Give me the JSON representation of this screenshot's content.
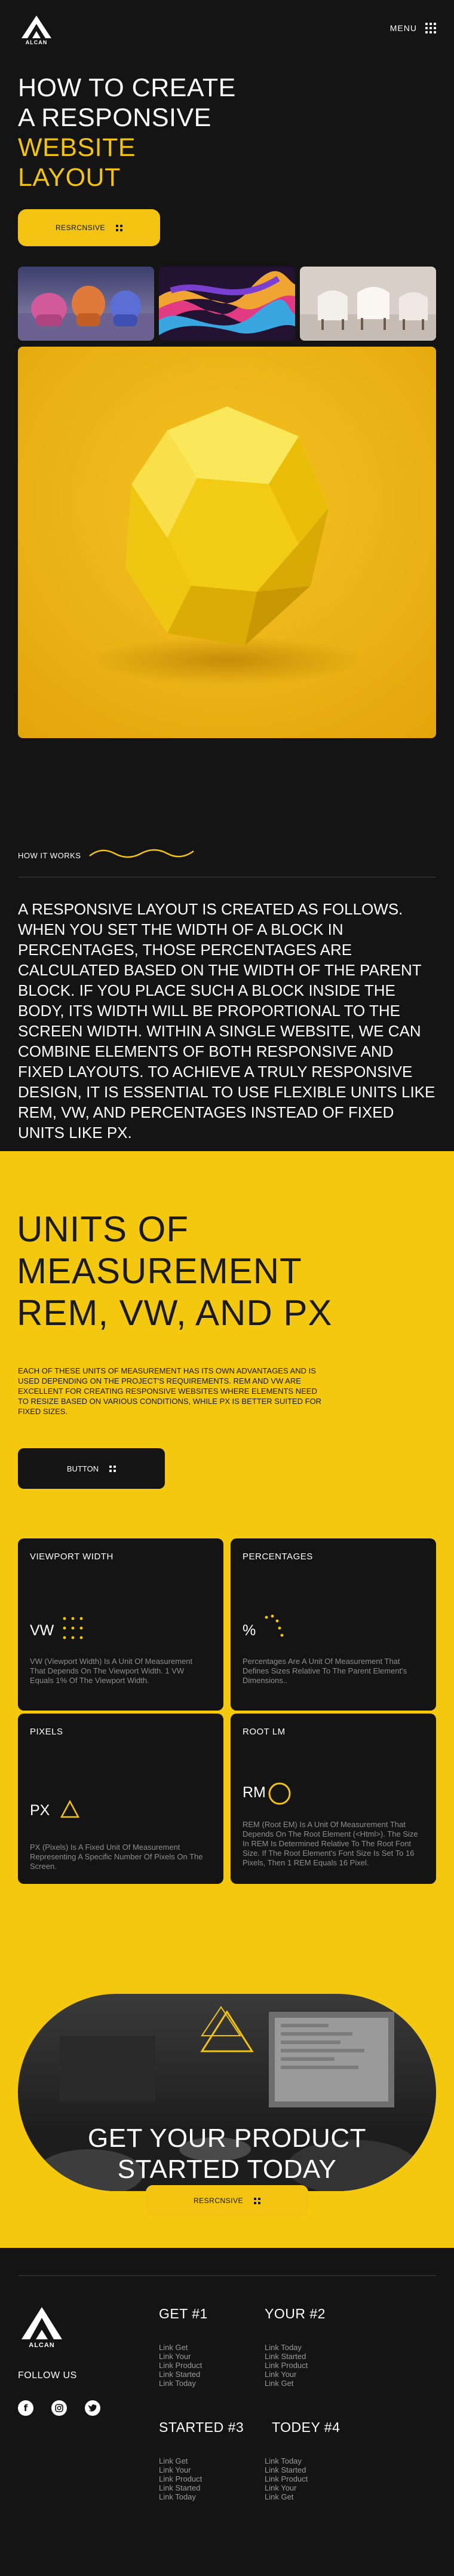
{
  "brand": {
    "logo_text": "ALCAN"
  },
  "nav": {
    "menu_label": "MENU"
  },
  "hero": {
    "title_line1": "HOW TO CREATE",
    "title_line2": "A RESPONSIVE",
    "title_line3": "WEBSITE",
    "title_line4": "LAYOUT",
    "button_label": "RESRCNSIVE"
  },
  "how_it_works": {
    "label": "HOW IT WORKS",
    "text": "A RESPONSIVE LAYOUT IS CREATED AS FOLLOWS. WHEN YOU SET THE WIDTH OF A BLOCK IN PERCENTAGES, THOSE PERCENTAGES ARE CALCULATED BASED ON THE WIDTH OF THE PARENT BLOCK. IF YOU PLACE SUCH A BLOCK INSIDE THE BODY, ITS WIDTH WILL BE PROPORTIONAL TO THE SCREEN WIDTH. WITHIN A SINGLE WEBSITE, WE CAN COMBINE ELEMENTS OF BOTH RESPONSIVE AND FIXED LAYOUTS. TO ACHIEVE A TRULY RESPONSIVE DESIGN, IT IS ESSENTIAL TO USE FLEXIBLE UNITS LIKE REM, VW, AND PERCENTAGES INSTEAD OF FIXED UNITS LIKE PX."
  },
  "units": {
    "title_line1": "UNITS OF",
    "title_line2": "MEASUREMENT",
    "title_line3": "REM, VW, AND PX",
    "description": "EACH OF THESE UNITS OF MEASUREMENT HAS ITS OWN ADVANTAGES AND IS USED DEPENDING ON THE PROJECT'S REQUIREMENTS. REM AND VW ARE EXCELLENT FOR CREATING RESPONSIVE WEBSITES WHERE ELEMENTS NEED TO RESIZE BASED ON VARIOUS CONDITIONS, WHILE PX IS BETTER SUITED FOR FIXED SIZES.",
    "button_label": "BUTTON"
  },
  "cards": [
    {
      "title": "VIEWPORT WIDTH",
      "label": "VW",
      "icon": "dot-grid-icon",
      "description": "VW (Viewport Width) Is A Unit Of Measurement That Depends On The Viewport Width. 1 VW Equals 1% Of The Viewport Width."
    },
    {
      "title": "PERCENTAGES",
      "label": "%",
      "icon": "dot-arc-icon",
      "description": "Percentages Are A Unit Of Measurement That Defines Sizes Relative To The Parent Element's Dimensions.."
    },
    {
      "title": "PIXELS",
      "label": "PX",
      "icon": "triangle-icon",
      "description": "PX (Pixels) Is A Fixed Unit Of Measurement Representing A Specific Number Of Pixels On The Screen."
    },
    {
      "title": "ROOT LM",
      "label": "RM",
      "icon": "circle-icon",
      "description": "REM (Root EM) Is A Unit Of Measurement That Depends On The Root Element (<Html>). The Size In REM Is Determined Relative To The Root Font Size. If The Root Element's Font Size Is Set To 16 Pixels, Then 1 REM Equals 16 Pixel."
    }
  ],
  "cta": {
    "title_line1": "GET YOUR PRODUCT",
    "title_line2": "STARTED TODAY",
    "button_label": "RESRCNSIVE"
  },
  "footer": {
    "logo_text": "ALCAN",
    "follow_label": "FOLLOW US",
    "columns": [
      {
        "title": "GET #1",
        "links": [
          "Link Get",
          "Link Your",
          "Link Product",
          "Link Started",
          "Link Today"
        ]
      },
      {
        "title": "YOUR #2",
        "links": [
          "Link Today",
          "Link Started",
          "Link Product",
          "Link Your",
          "Link Get"
        ]
      },
      {
        "title": "STARTED #3",
        "links": [
          "Link Get",
          "Link Your",
          "Link Product",
          "Link Started",
          "Link Today"
        ]
      },
      {
        "title": "TODEY #4",
        "links": [
          "Link Today",
          "Link Started",
          "Link Product",
          "Link Your",
          "Link Get"
        ]
      }
    ],
    "social": [
      "facebook-icon",
      "instagram-icon",
      "twitter-icon"
    ]
  },
  "colors": {
    "accent": "#f2c311",
    "background": "#141414",
    "card": "#141414",
    "muted_text": "#8e8e8e"
  }
}
